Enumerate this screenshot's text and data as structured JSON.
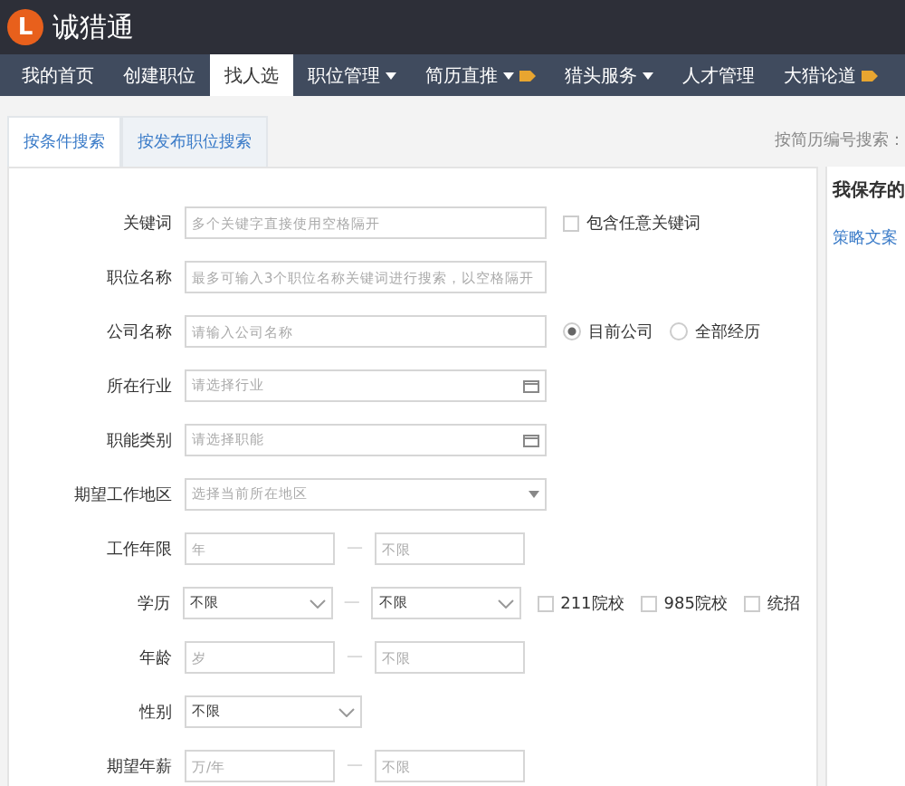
{
  "header": {
    "logo_letter": "L",
    "brand": "诚猎通"
  },
  "nav": [
    {
      "label": "我的首页",
      "selected": false,
      "has_menu": false,
      "badge": false
    },
    {
      "label": "创建职位",
      "selected": false,
      "has_menu": false,
      "badge": false
    },
    {
      "label": "找人选",
      "selected": true,
      "has_menu": false,
      "badge": false
    },
    {
      "label": "职位管理",
      "selected": false,
      "has_menu": true,
      "badge": false
    },
    {
      "label": "简历直推",
      "selected": false,
      "has_menu": true,
      "badge": true
    },
    {
      "label": "猎头服务",
      "selected": false,
      "has_menu": true,
      "badge": false
    },
    {
      "label": "人才管理",
      "selected": false,
      "has_menu": false,
      "badge": false
    },
    {
      "label": "大猎论道",
      "selected": false,
      "has_menu": false,
      "badge": true
    }
  ],
  "tabs": [
    {
      "label": "按条件搜索",
      "selected": true
    },
    {
      "label": "按发布职位搜索",
      "selected": false
    }
  ],
  "resume_search_label": "按简历编号搜索：",
  "side_panel": {
    "title": "我保存的",
    "link": "策略文案"
  },
  "form": [
    {
      "label": "关键词",
      "kind": "text",
      "placeholder": "多个关键字直接使用空格隔开",
      "extras": [
        {
          "kind": "checkbox",
          "label": "包含任意关键词",
          "checked": false
        }
      ]
    },
    {
      "label": "职位名称",
      "kind": "text",
      "placeholder": "最多可输入3个职位名称关键词进行搜索，以空格隔开"
    },
    {
      "label": "公司名称",
      "kind": "text",
      "placeholder": "请输入公司名称",
      "extras": [
        {
          "kind": "radio",
          "label": "目前公司",
          "selected": true
        },
        {
          "kind": "radio",
          "label": "全部经历",
          "selected": false
        }
      ]
    },
    {
      "label": "所在行业",
      "kind": "picker",
      "placeholder": "请选择行业"
    },
    {
      "label": "职能类别",
      "kind": "picker",
      "placeholder": "请选择职能"
    },
    {
      "label": "期望工作地区",
      "kind": "dropdown",
      "placeholder": "选择当前所在地区"
    },
    {
      "label": "工作年限",
      "kind": "range",
      "fields": [
        {
          "placeholder": "年"
        },
        {
          "placeholder": "不限"
        }
      ],
      "separator": "—"
    },
    {
      "label": "学历",
      "kind": "select_range",
      "from": "不限",
      "separator": "—",
      "to": "不限",
      "extras": [
        {
          "kind": "checkbox",
          "label": "211院校",
          "checked": false
        },
        {
          "kind": "checkbox",
          "label": "985院校",
          "checked": false
        },
        {
          "kind": "checkbox",
          "label": "统招",
          "checked": false
        }
      ]
    },
    {
      "label": "年龄",
      "kind": "range",
      "fields": [
        {
          "placeholder": "岁"
        },
        {
          "placeholder": "不限"
        }
      ],
      "separator": "—"
    },
    {
      "label": "性别",
      "kind": "select",
      "value": "不限"
    },
    {
      "label": "期望年薪",
      "kind": "range",
      "fields": [
        {
          "placeholder": "万/年"
        },
        {
          "placeholder": "不限"
        }
      ],
      "separator": "—"
    }
  ]
}
